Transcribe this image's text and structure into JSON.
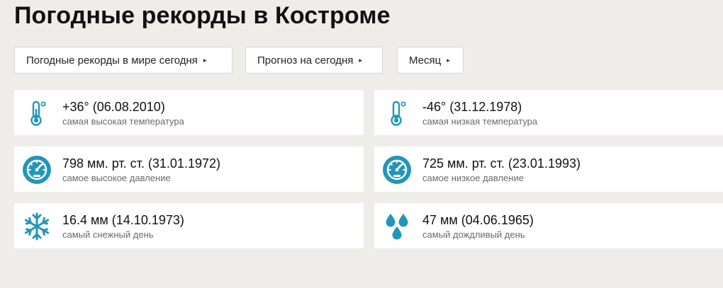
{
  "page": {
    "title": "Погодные рекорды в Костроме"
  },
  "nav": [
    {
      "label": "Погодные рекорды в мире сегодня",
      "caret": "▸"
    },
    {
      "label": "Прогноз на сегодня",
      "caret": "▸"
    },
    {
      "label": "Месяц",
      "caret": "▸"
    }
  ],
  "colors": {
    "icon_accent": "#2396b8",
    "background": "#eeede9"
  },
  "records": [
    {
      "icon": "thermometer-icon",
      "value": "+36° (06.08.2010)",
      "label": "самая высокая температура"
    },
    {
      "icon": "thermometer-icon",
      "value": "-46° (31.12.1978)",
      "label": "самая низкая температура"
    },
    {
      "icon": "barometer-icon",
      "value": "798 мм. рт. ст. (31.01.1972)",
      "label": "самое высокое давление"
    },
    {
      "icon": "barometer-icon",
      "value": "725 мм. рт. ст. (23.01.1993)",
      "label": "самое низкое давление"
    },
    {
      "icon": "snowflake-icon",
      "value": "16.4 мм (14.10.1973)",
      "label": "самый снежный день"
    },
    {
      "icon": "raindrops-icon",
      "value": "47 мм (04.06.1965)",
      "label": "самый дождливый день"
    }
  ]
}
